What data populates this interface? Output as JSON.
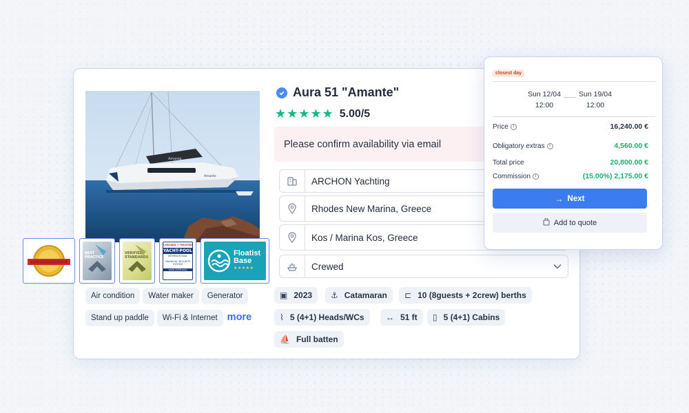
{
  "listing": {
    "title": "Aura 51 \"Amante\"",
    "rating": "5.00/5",
    "stars": "★★★★★",
    "confirm_text": "Please confirm availability via email",
    "company": "ARCHON Yachting",
    "base_from": "Rhodes New Marina, Greece",
    "base_to": "Kos / Marina Kos, Greece",
    "crew_type": "Crewed",
    "boat_name_on_hull": "Amante"
  },
  "badges": {
    "floatist_line1": "Floatist",
    "floatist_line2": "Base",
    "floatist_stars": "★★★★★",
    "yachtpool_line1": "YACHT-POOL",
    "yachtpool_line2": "INTERNATIONAL",
    "yachtpool_line3": "FINANCIAL SECURITY SYSTEM",
    "yachtpool_line4": "valid 2026 only",
    "yachtpool_top": "CHECKED + TRUSTED",
    "best_practice": "BEST PRACTICE",
    "verified_standards": "VERIFIED STANDARDS"
  },
  "amenities": {
    "items": [
      "Air condition",
      "Water maker",
      "Generator",
      "Stand up paddle",
      "Wi-Fi & Internet"
    ],
    "more": "more"
  },
  "specs": {
    "year": "2023",
    "type": "Catamaran",
    "berths": "10 (8guests + 2crew) berths",
    "heads": "5 (4+1) Heads/WCs",
    "length": "51 ft",
    "cabins": "5 (4+1) Cabins",
    "sail": "Full batten"
  },
  "pricing": {
    "tag": "closest day",
    "from_date": "Sun 12/04",
    "from_time": "12:00",
    "to_date": "Sun 19/04",
    "to_time": "12:00",
    "price_label": "Price",
    "price_value": "16,240.00 €",
    "extras_label": "Obligatory extras",
    "extras_value": "4,560.00 €",
    "total_label": "Total price",
    "total_value": "20,800.00 €",
    "commission_label": "Commission",
    "commission_value": "(15.00%) 2,175.00 €",
    "next_label": "Next",
    "quote_label": "Add to quote"
  },
  "colors": {
    "accent": "#3d7cf0",
    "green": "#13b36b",
    "stars": "#12b886",
    "confirm_bg": "#fdf0f3",
    "floatist": "#1aa3b8"
  },
  "icons": {
    "verified": "verified-check-icon",
    "company": "building-icon",
    "location": "map-pin-icon",
    "crew": "ship-icon",
    "year": "calendar-icon",
    "type": "anchor-icon",
    "berths": "bed-icon",
    "heads": "shower-icon",
    "length": "arrows-horizontal-icon",
    "cabins": "door-icon",
    "sail": "sailboat-icon",
    "next": "arrow-right-icon",
    "quote": "bag-icon",
    "info": "info-icon"
  }
}
